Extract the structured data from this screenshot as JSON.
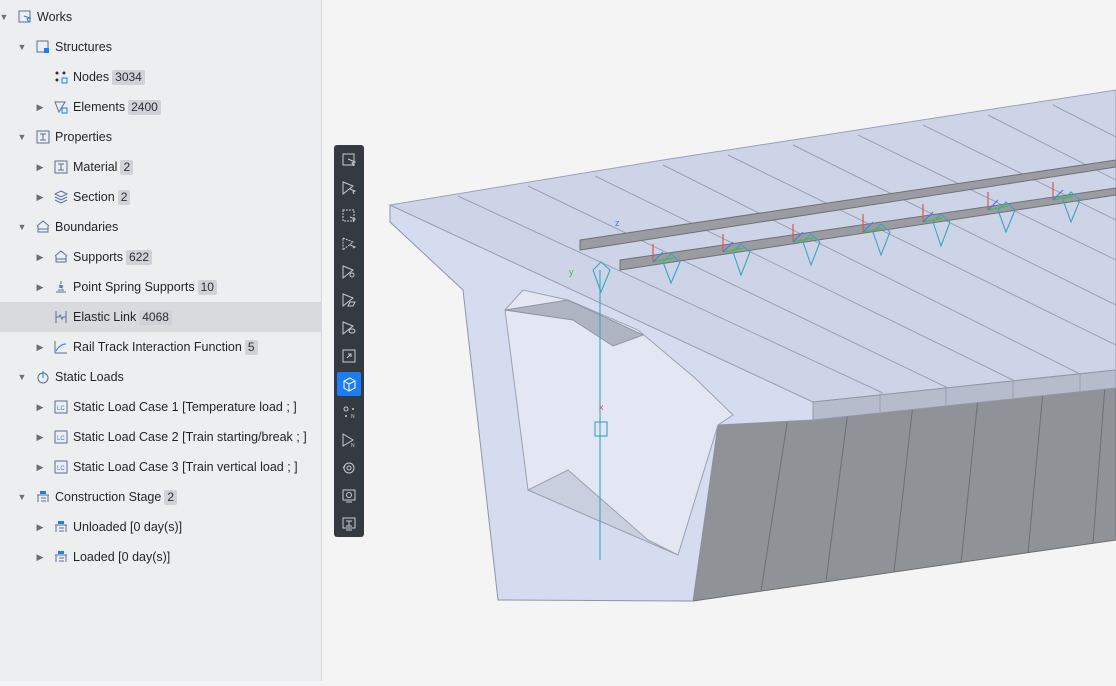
{
  "tree": {
    "items": [
      {
        "key": "works",
        "label": "Works",
        "badge": null,
        "level": 0,
        "expanded": true,
        "has_children": true
      },
      {
        "key": "structures",
        "label": "Structures",
        "badge": null,
        "level": 1,
        "expanded": true,
        "has_children": true
      },
      {
        "key": "nodes",
        "label": "Nodes",
        "badge": "3034",
        "level": 2,
        "expanded": false,
        "has_children": false
      },
      {
        "key": "elements",
        "label": "Elements",
        "badge": "2400",
        "level": 2,
        "expanded": false,
        "has_children": true
      },
      {
        "key": "properties",
        "label": "Properties",
        "badge": null,
        "level": 1,
        "expanded": true,
        "has_children": true
      },
      {
        "key": "material",
        "label": "Material",
        "badge": "2",
        "level": 2,
        "expanded": false,
        "has_children": true
      },
      {
        "key": "section",
        "label": "Section",
        "badge": "2",
        "level": 2,
        "expanded": false,
        "has_children": true
      },
      {
        "key": "boundaries",
        "label": "Boundaries",
        "badge": null,
        "level": 1,
        "expanded": true,
        "has_children": true
      },
      {
        "key": "supports",
        "label": "Supports",
        "badge": "622",
        "level": 2,
        "expanded": false,
        "has_children": true
      },
      {
        "key": "point-spring-supports",
        "label": "Point Spring Supports",
        "badge": "10",
        "level": 2,
        "expanded": false,
        "has_children": true
      },
      {
        "key": "elastic-link",
        "label": "Elastic Link",
        "badge": "4068",
        "level": 2,
        "expanded": false,
        "has_children": false,
        "selected": true
      },
      {
        "key": "rail-track-interaction-function",
        "label": "Rail Track Interaction Function",
        "badge": "5",
        "level": 2,
        "expanded": false,
        "has_children": true
      },
      {
        "key": "static-loads",
        "label": "Static Loads",
        "badge": null,
        "level": 1,
        "expanded": true,
        "has_children": true
      },
      {
        "key": "static-load-case-1",
        "label": "Static Load Case 1 [Temperature load ; ]",
        "badge": null,
        "level": 2,
        "expanded": false,
        "has_children": true
      },
      {
        "key": "static-load-case-2",
        "label": "Static Load Case 2 [Train starting/break ; ]",
        "badge": null,
        "level": 2,
        "expanded": false,
        "has_children": true
      },
      {
        "key": "static-load-case-3",
        "label": "Static Load Case 3 [Train vertical load ; ]",
        "badge": null,
        "level": 2,
        "expanded": false,
        "has_children": true
      },
      {
        "key": "construction-stage",
        "label": "Construction Stage",
        "badge": "2",
        "level": 1,
        "expanded": true,
        "has_children": true
      },
      {
        "key": "unloaded",
        "label": "Unloaded [0 day(s)]",
        "badge": null,
        "level": 2,
        "expanded": false,
        "has_children": true
      },
      {
        "key": "loaded",
        "label": "Loaded [0 day(s)]",
        "badge": null,
        "level": 2,
        "expanded": false,
        "has_children": true
      }
    ],
    "icon_names": [
      "works-icon",
      "structures-icon",
      "nodes-icon",
      "elements-icon",
      "properties-icon",
      "material-icon",
      "section-icon",
      "boundaries-icon",
      "supports-icon",
      "point-spring-supports-icon",
      "elastic-link-icon",
      "rail-track-function-icon",
      "static-loads-icon",
      "load-case-icon",
      "load-case-icon",
      "load-case-icon",
      "construction-stage-icon",
      "stage-icon",
      "stage-icon"
    ]
  },
  "toolbar": {
    "buttons": [
      {
        "name": "select-single-button",
        "icon": "select-single-icon",
        "active": false
      },
      {
        "name": "select-window-button",
        "icon": "select-window-icon",
        "active": false
      },
      {
        "name": "select-box-button",
        "icon": "select-box-icon",
        "active": false
      },
      {
        "name": "select-polygon-button",
        "icon": "select-polygon-icon",
        "active": false
      },
      {
        "name": "select-view-button",
        "icon": "select-view-icon",
        "active": false
      },
      {
        "name": "select-plane-button",
        "icon": "select-plane-icon",
        "active": false
      },
      {
        "name": "select-hide-button",
        "icon": "select-hide-icon",
        "active": false
      },
      {
        "name": "zoom-window-button",
        "icon": "zoom-window-icon",
        "active": false
      },
      {
        "name": "view-3d-button",
        "icon": "view-3d-icon",
        "active": true
      },
      {
        "name": "node-number-button",
        "icon": "node-number-icon",
        "active": false
      },
      {
        "name": "element-number-button",
        "icon": "element-number-icon",
        "active": false
      },
      {
        "name": "rotate-view-button",
        "icon": "rotate-view-icon",
        "active": false
      },
      {
        "name": "display-button",
        "icon": "display-icon",
        "active": false
      },
      {
        "name": "display-options-button",
        "icon": "display-options-icon",
        "active": false
      }
    ]
  },
  "viewport": {
    "axis_labels": {
      "x": "x",
      "y": "y",
      "z": "z"
    },
    "colors": {
      "accent": "#1c7ef2",
      "link": "#3aa5c4",
      "x_axis": "#e0564b",
      "y_axis": "#3fbf4a",
      "z_axis": "#3f7ef0"
    }
  }
}
